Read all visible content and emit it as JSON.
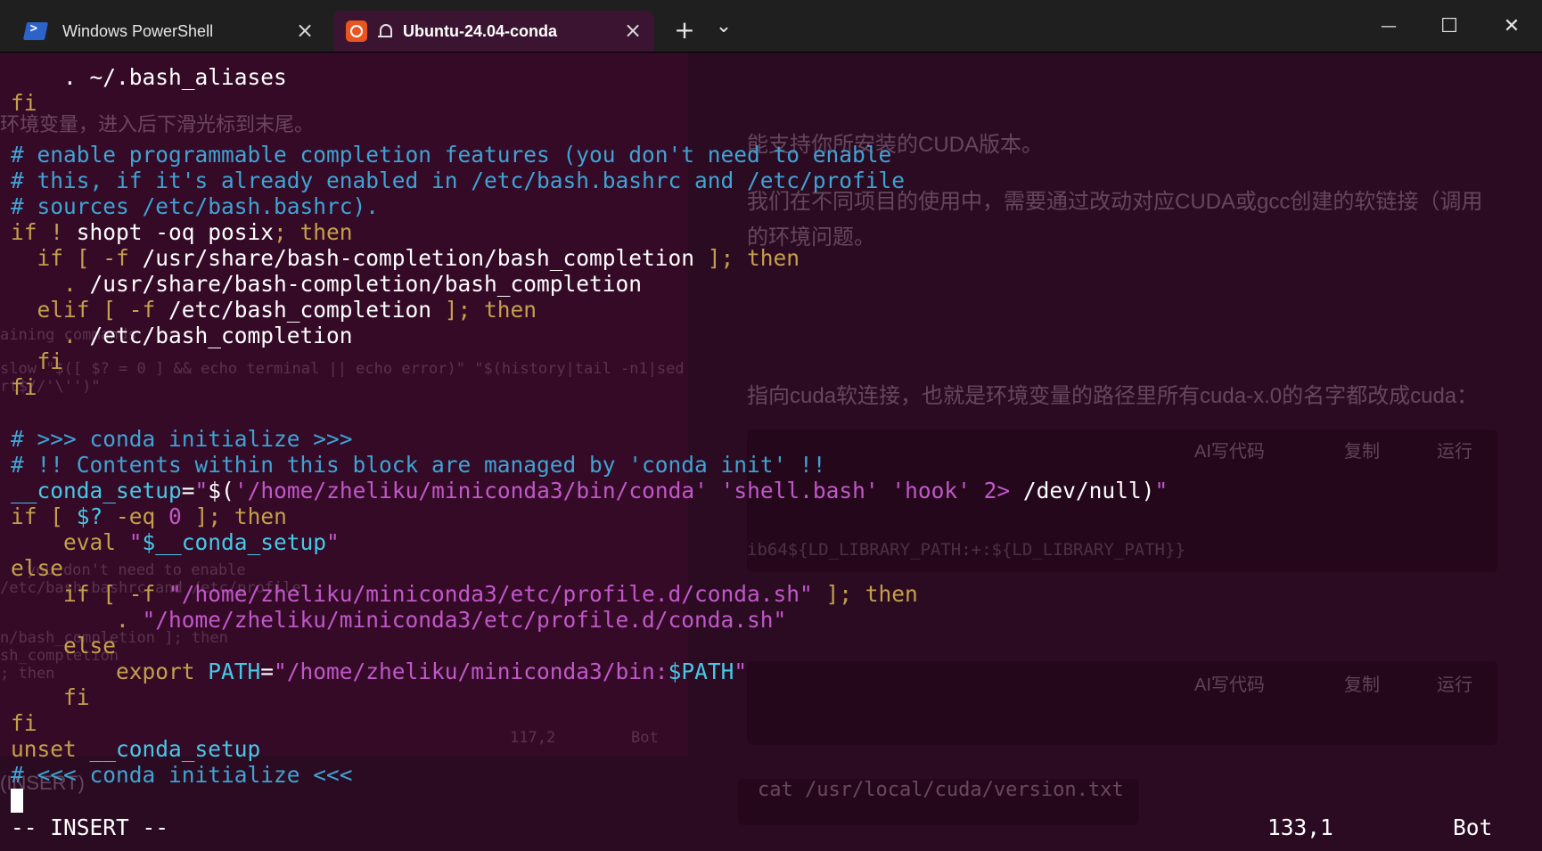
{
  "tabs": [
    {
      "label": "Windows PowerShell",
      "icon": "powershell-icon",
      "active": false
    },
    {
      "label": "Ubuntu-24.04-conda",
      "icon": "ubuntu-icon",
      "active": true
    }
  ],
  "controls": {
    "new_tab": "+",
    "dropdown": "⌄",
    "minimize": "—",
    "maximize": "☐",
    "close": "✕",
    "tab_close": "×"
  },
  "background": {
    "texts": [
      "环境变量，进入后下滑光标到末尾。",
      "能支持你所安装的CUDA版本。",
      "我们在不同项目的使用中，需要通过改动对应CUDA或gcc创建的软链接（调用",
      "的环境问题。",
      "指向cuda软连接，也就是环境变量的路径里所有cuda-x.0的名字都改成cuda："
    ],
    "code_toolbar": {
      "ai": "AI写代码",
      "copy": "复制",
      "run": "运行"
    },
    "code_1": "ib64${LD_LIBRARY_PATH:+:${LD_LIBRARY_PATH}}",
    "code_2": "cat /usr/local/cuda/version.txt",
    "ghost_mono": [
      "aining commands",
      "slow \"$([ $? = 0 ] && echo terminal || echo error)\" \"$(history|tail -n1|sed",
      "rt$//'\\'')\"",
      "you don't need to enable",
      "/etc/bash.bashrc and /etc/profile",
      "n/bash_completion ]; then",
      "sh_completion",
      "; then",
      "117,2",
      "Bot",
      "(INSERT)"
    ]
  },
  "editor": {
    "lines": [
      [
        {
          "t": "    . ~/.bash_aliases",
          "c": ""
        }
      ],
      [
        {
          "t": "fi",
          "c": "kw"
        }
      ],
      [
        {
          "t": "",
          "c": ""
        }
      ],
      [
        {
          "t": "# enable programmable completion features (you don't need to enable",
          "c": "com"
        }
      ],
      [
        {
          "t": "# this, if it's already enabled in /etc/bash.bashrc and /etc/profile",
          "c": "com"
        }
      ],
      [
        {
          "t": "# sources /etc/bash.bashrc).",
          "c": "com"
        }
      ],
      [
        {
          "t": "if",
          "c": "kw"
        },
        {
          "t": " ! ",
          "c": "op"
        },
        {
          "t": "shopt -oq posix",
          "c": ""
        },
        {
          "t": "; then",
          "c": "kw"
        }
      ],
      [
        {
          "t": "  if [ -f ",
          "c": "kw"
        },
        {
          "t": "/usr/share/bash-completion/bash_completion",
          "c": ""
        },
        {
          "t": " ]; then",
          "c": "kw"
        }
      ],
      [
        {
          "t": "    . ",
          "c": "kw"
        },
        {
          "t": "/usr/share/bash-completion/bash_completion",
          "c": ""
        }
      ],
      [
        {
          "t": "  elif [ -f ",
          "c": "kw"
        },
        {
          "t": "/etc/bash_completion",
          "c": ""
        },
        {
          "t": " ]; then",
          "c": "kw"
        }
      ],
      [
        {
          "t": "    . ",
          "c": "kw"
        },
        {
          "t": "/etc/bash_completion",
          "c": ""
        }
      ],
      [
        {
          "t": "  fi",
          "c": "kw"
        }
      ],
      [
        {
          "t": "fi",
          "c": "kw"
        }
      ],
      [
        {
          "t": "",
          "c": ""
        }
      ],
      [
        {
          "t": "# >>> conda initialize >>>",
          "c": "com"
        }
      ],
      [
        {
          "t": "# !! Contents within this block are managed by 'conda init' !!",
          "c": "com"
        }
      ],
      [
        {
          "t": "__conda_setup",
          "c": "var"
        },
        {
          "t": "=",
          "c": ""
        },
        {
          "t": "\"",
          "c": "str"
        },
        {
          "t": "$(",
          "c": ""
        },
        {
          "t": "'/home/zheliku/miniconda3/bin/conda'",
          "c": "str"
        },
        {
          "t": " ",
          "c": ""
        },
        {
          "t": "'shell.bash'",
          "c": "str"
        },
        {
          "t": " ",
          "c": ""
        },
        {
          "t": "'hook'",
          "c": "str"
        },
        {
          "t": " ",
          "c": ""
        },
        {
          "t": "2>",
          "c": "str"
        },
        {
          "t": " /dev/null)",
          "c": ""
        },
        {
          "t": "\"",
          "c": "str"
        }
      ],
      [
        {
          "t": "if [ ",
          "c": "kw"
        },
        {
          "t": "$?",
          "c": "var"
        },
        {
          "t": " -eq ",
          "c": "kw"
        },
        {
          "t": "0",
          "c": "str"
        },
        {
          "t": " ]; then",
          "c": "kw"
        }
      ],
      [
        {
          "t": "    eval ",
          "c": "kw"
        },
        {
          "t": "\"",
          "c": "str"
        },
        {
          "t": "$__conda_setup",
          "c": "var"
        },
        {
          "t": "\"",
          "c": "str"
        }
      ],
      [
        {
          "t": "else",
          "c": "kw"
        }
      ],
      [
        {
          "t": "    if [ -f ",
          "c": "kw"
        },
        {
          "t": "\"/home/zheliku/miniconda3/etc/profile.d/conda.sh\"",
          "c": "str"
        },
        {
          "t": " ]; then",
          "c": "kw"
        }
      ],
      [
        {
          "t": "        . ",
          "c": "kw"
        },
        {
          "t": "\"/home/zheliku/miniconda3/etc/profile.d/conda.sh\"",
          "c": "str"
        }
      ],
      [
        {
          "t": "    else",
          "c": "kw"
        }
      ],
      [
        {
          "t": "        export ",
          "c": "kw"
        },
        {
          "t": "PATH",
          "c": "var"
        },
        {
          "t": "=",
          "c": ""
        },
        {
          "t": "\"/home/zheliku/miniconda3/bin:",
          "c": "str"
        },
        {
          "t": "$PATH",
          "c": "var"
        },
        {
          "t": "\"",
          "c": "str"
        }
      ],
      [
        {
          "t": "    fi",
          "c": "kw"
        }
      ],
      [
        {
          "t": "fi",
          "c": "kw"
        }
      ],
      [
        {
          "t": "unset ",
          "c": "kw"
        },
        {
          "t": "__conda_setup",
          "c": "var"
        }
      ],
      [
        {
          "t": "# <<< conda initialize <<<",
          "c": "com"
        }
      ]
    ],
    "status": {
      "mode": "-- INSERT --",
      "position": "133,1",
      "scroll": "Bot"
    }
  }
}
